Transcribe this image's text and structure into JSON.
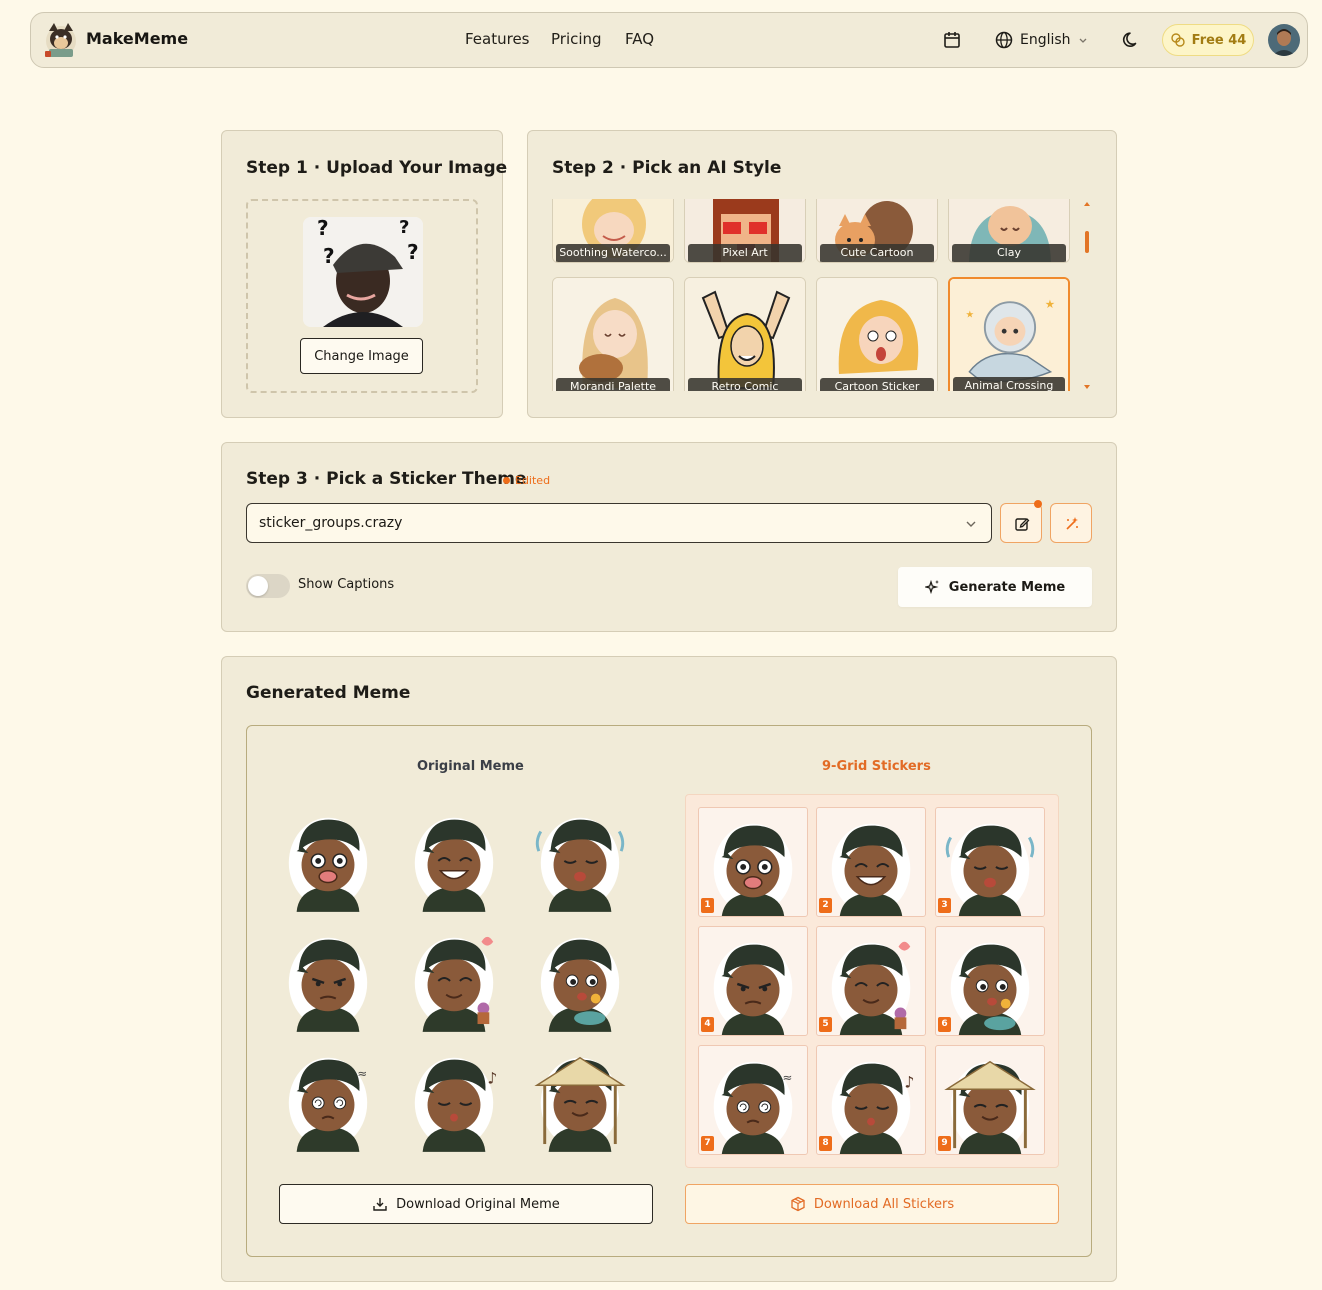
{
  "nav": {
    "brand": "MakeMeme",
    "links": [
      "Features",
      "Pricing",
      "FAQ"
    ],
    "language": "English",
    "credits": "Free 44"
  },
  "step1": {
    "title": "Step 1 · Upload Your Image",
    "change_button": "Change Image"
  },
  "step2": {
    "title": "Step 2 · Pick an AI Style",
    "styles": [
      {
        "label": "Soothing Waterco...",
        "selected": false
      },
      {
        "label": "Pixel Art",
        "selected": false
      },
      {
        "label": "Cute Cartoon",
        "selected": false
      },
      {
        "label": "Clay",
        "selected": false
      },
      {
        "label": "Morandi Palette",
        "selected": false
      },
      {
        "label": "Retro Comic",
        "selected": false
      },
      {
        "label": "Cartoon Sticker",
        "selected": false
      },
      {
        "label": "Animal Crossing",
        "selected": true
      }
    ]
  },
  "step3": {
    "title": "Step 3 · Pick a Sticker Theme",
    "edited_badge": "Edited",
    "theme_value": "sticker_groups.crazy",
    "show_captions_label": "Show Captions",
    "show_captions": false,
    "generate_label": "Generate Meme"
  },
  "result": {
    "title": "Generated Meme",
    "original_title": "Original Meme",
    "grid_title": "9-Grid Stickers",
    "cell_numbers": [
      "1",
      "2",
      "3",
      "4",
      "5",
      "6",
      "7",
      "8",
      "9"
    ],
    "download_original": "Download Original Meme",
    "download_all": "Download All Stickers"
  },
  "colors": {
    "accent": "#ee6d1a",
    "page_bg": "#fef9e9",
    "card_bg": "#f1ebd8"
  }
}
